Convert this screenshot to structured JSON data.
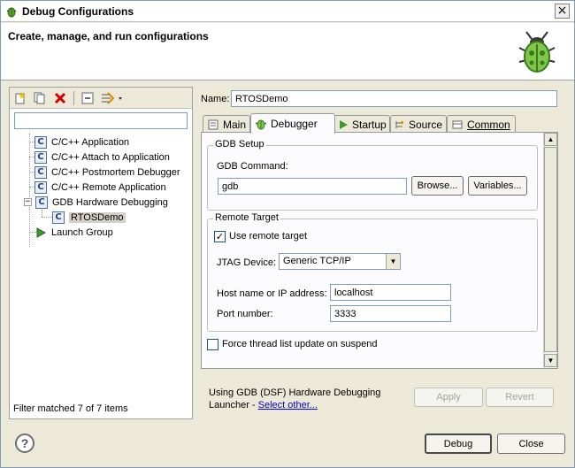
{
  "window": {
    "title": "Debug Configurations"
  },
  "banner": {
    "title": "Create, manage, and run configurations"
  },
  "left": {
    "filter_placeholder": "",
    "tree": [
      {
        "label": "C/C++ Application",
        "icon": "c-config-icon"
      },
      {
        "label": "C/C++ Attach to Application",
        "icon": "c-config-icon"
      },
      {
        "label": "C/C++ Postmortem Debugger",
        "icon": "c-config-icon"
      },
      {
        "label": "C/C++ Remote Application",
        "icon": "c-config-icon"
      },
      {
        "label": "GDB Hardware Debugging",
        "icon": "c-config-icon",
        "expanded": true
      },
      {
        "label": "RTOSDemo",
        "icon": "c-config-icon",
        "selected": true
      },
      {
        "label": "Launch Group",
        "icon": "launch-arrow-icon"
      }
    ],
    "filter_status": "Filter matched 7 of 7 items"
  },
  "form": {
    "name_label": "Name:",
    "name_value": "RTOSDemo",
    "tabs": [
      {
        "label": "Main"
      },
      {
        "label": "Debugger",
        "active": true
      },
      {
        "label": "Startup"
      },
      {
        "label": "Source"
      },
      {
        "label": "Common"
      }
    ],
    "gdb_setup": {
      "title": "GDB Setup",
      "command_label": "GDB Command:",
      "command_value": "gdb",
      "browse_label": "Browse...",
      "variables_label": "Variables..."
    },
    "remote_target": {
      "title": "Remote Target",
      "use_remote_label": "Use remote target",
      "use_remote_checked": true,
      "jtag_label": "JTAG Device:",
      "jtag_value": "Generic TCP/IP",
      "host_label": "Host name or IP address:",
      "host_value": "localhost",
      "port_label": "Port number:",
      "port_value": "3333"
    },
    "force_thread_label": "Force thread list update on suspend",
    "force_thread_checked": false
  },
  "launcher": {
    "text": "Using GDB (DSF) Hardware Debugging Launcher - ",
    "link": "Select other..."
  },
  "buttons": {
    "apply": "Apply",
    "revert": "Revert",
    "debug": "Debug",
    "close": "Close"
  },
  "colors": {
    "accent": "#0000cc",
    "window_bg": "#ece9d8"
  }
}
